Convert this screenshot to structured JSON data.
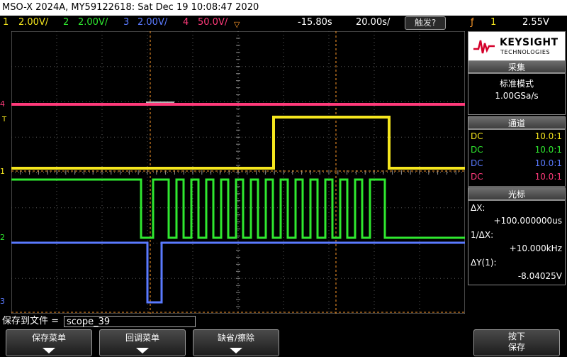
{
  "title": "MSO-X 2024A, MY59122618: Sat Dec 19 10:08:47 2020",
  "channels": [
    {
      "num": "1",
      "scale": "2.00V/",
      "color": "#f5e61e"
    },
    {
      "num": "2",
      "scale": "2.00V/",
      "color": "#2fe82f"
    },
    {
      "num": "3",
      "scale": "2.00V/",
      "color": "#5a7aff"
    },
    {
      "num": "4",
      "scale": "50.0V/",
      "color": "#ff3a7a"
    }
  ],
  "timebase": {
    "delay": "-15.80s",
    "scale": "20.00s/"
  },
  "trigger": {
    "mode_button": "触发?",
    "channel": "1",
    "level": "2.55V"
  },
  "logo": {
    "brand": "KEYSIGHT",
    "sub": "TECHNOLOGIES"
  },
  "acquisition": {
    "header": "采集",
    "mode": "标准模式",
    "rate": "1.00GSa/s"
  },
  "channels_panel": {
    "header": "通道",
    "rows": [
      {
        "coupling": "DC",
        "probe": "10.0:1",
        "color": "#f5e61e"
      },
      {
        "coupling": "DC",
        "probe": "10.0:1",
        "color": "#2fe82f"
      },
      {
        "coupling": "DC",
        "probe": "10.0:1",
        "color": "#5a7aff"
      },
      {
        "coupling": "DC",
        "probe": "10.0:1",
        "color": "#ff3a7a"
      }
    ]
  },
  "cursors": {
    "header": "光标",
    "dx_label": "ΔX:",
    "dx_value": "+100.000000us",
    "inv_label": "1/ΔX:",
    "inv_value": "+10.000kHz",
    "dy_label": "ΔY(1):",
    "dy_value": "-8.04025V"
  },
  "save": {
    "label": "保存到文件 =",
    "filename": "scope_39"
  },
  "softkeys": [
    "保存菜单",
    "回调菜单",
    "缺省/擦除"
  ],
  "save_key": {
    "line1": "按下",
    "line2": "保存"
  },
  "markers": {
    "ch4": "4",
    "ch1": "1",
    "ch2": "2",
    "ch3": "3",
    "trig": "T"
  }
}
